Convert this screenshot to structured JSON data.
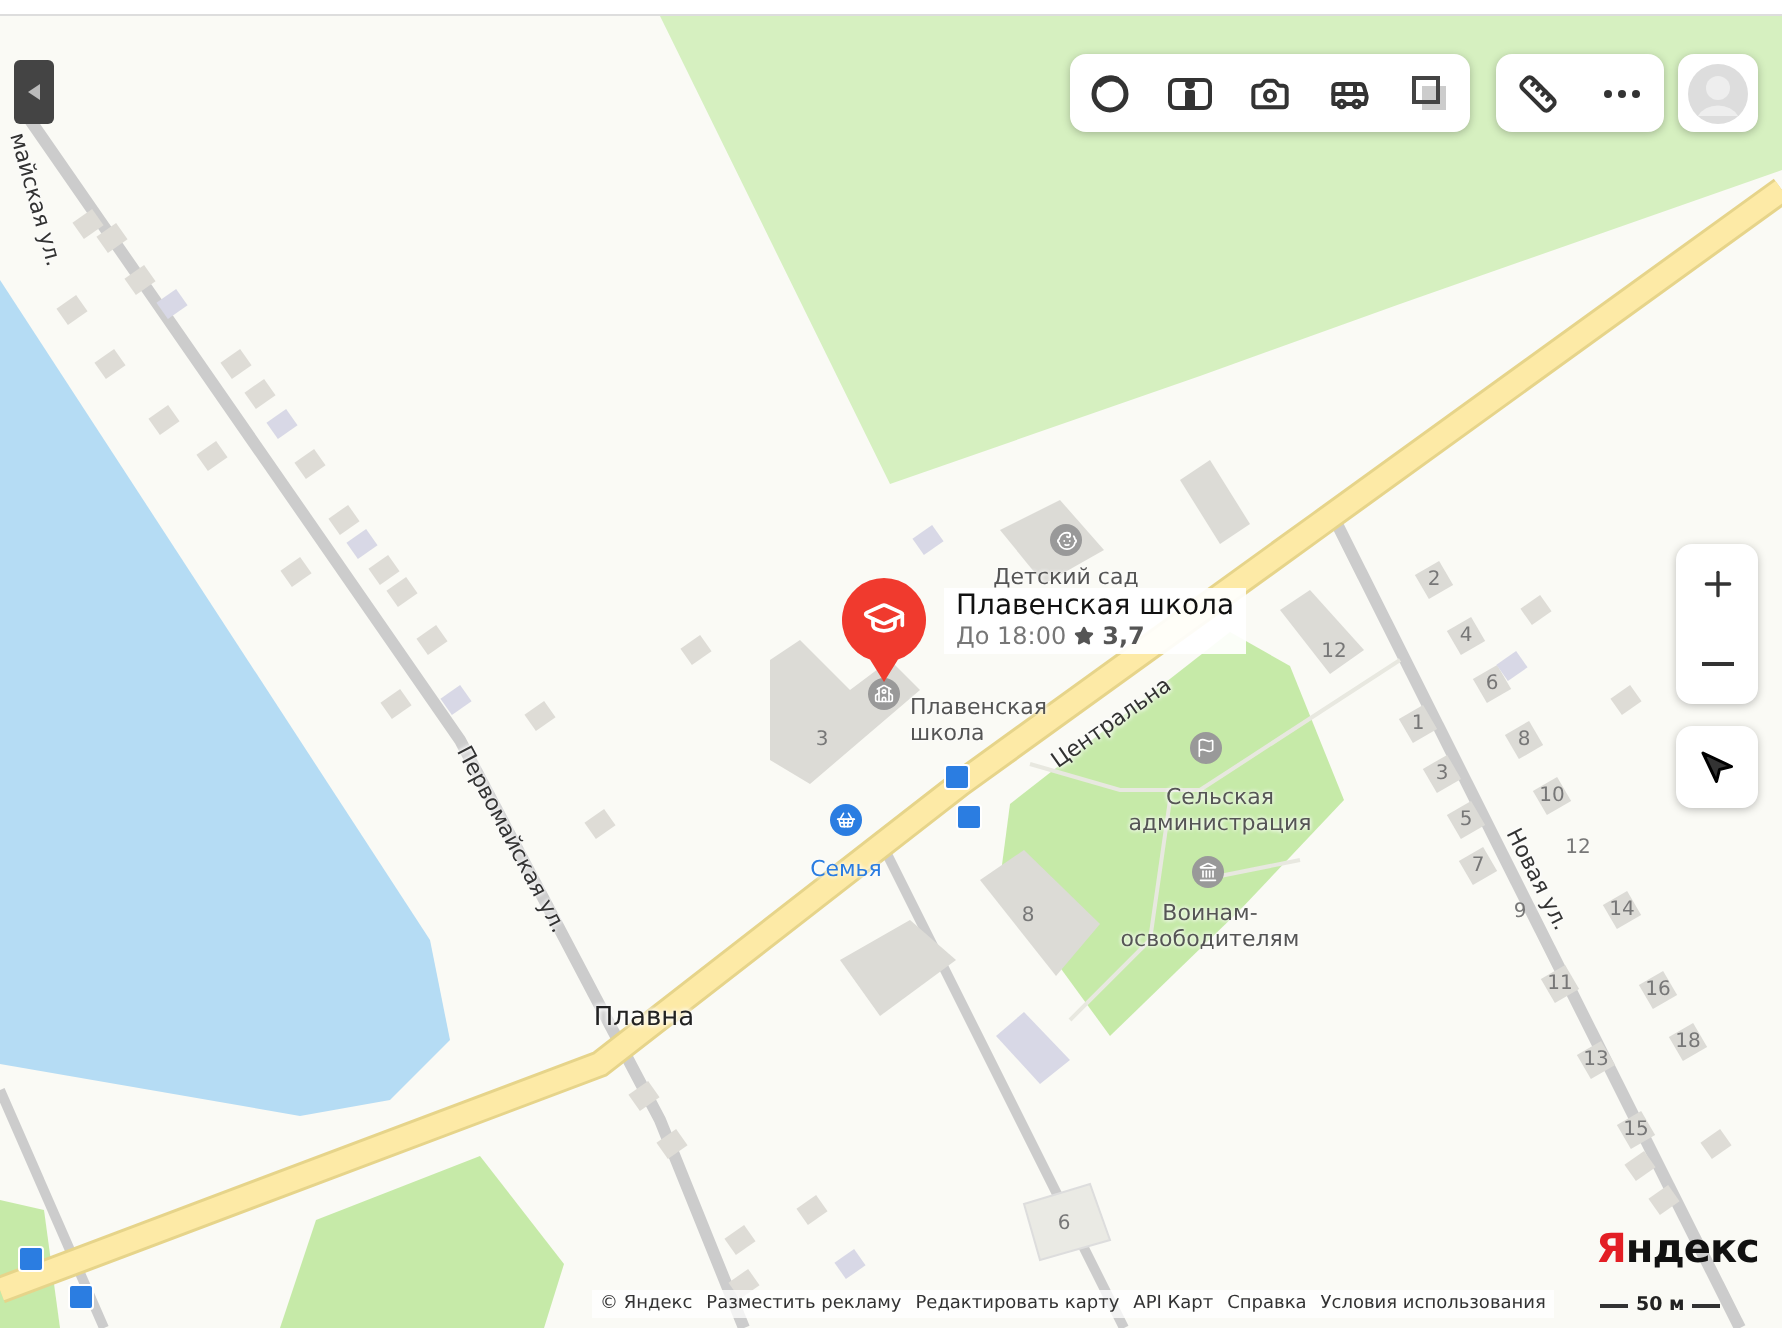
{
  "popup": {
    "title": "Плавенская школа",
    "hours": "До 18:00",
    "rating": "3,7"
  },
  "pois": [
    {
      "name": "Детский сад",
      "kind": "kindergarten"
    },
    {
      "name": "Плавенская школа",
      "kind": "school"
    },
    {
      "name": "Сельская администрация",
      "kind": "government"
    },
    {
      "name": "Воинам-освободителям",
      "kind": "monument"
    },
    {
      "name": "Семья",
      "kind": "shop"
    }
  ],
  "streets": [
    "майская ул.",
    "Первомайская ул.",
    "Центральна",
    "Новая ул."
  ],
  "place": "Плавна",
  "house_numbers": [
    "3",
    "12",
    "8",
    "6",
    "2",
    "4",
    "6",
    "8",
    "10",
    "12",
    "14",
    "16",
    "18",
    "1",
    "3",
    "5",
    "7",
    "9",
    "11",
    "13",
    "15"
  ],
  "logo": "Яндекс",
  "footer_links": [
    "© Яндекс",
    "Разместить рекламу",
    "Редактировать карту",
    "API Карт",
    "Справка",
    "Условия использования"
  ],
  "scale": "50 м"
}
